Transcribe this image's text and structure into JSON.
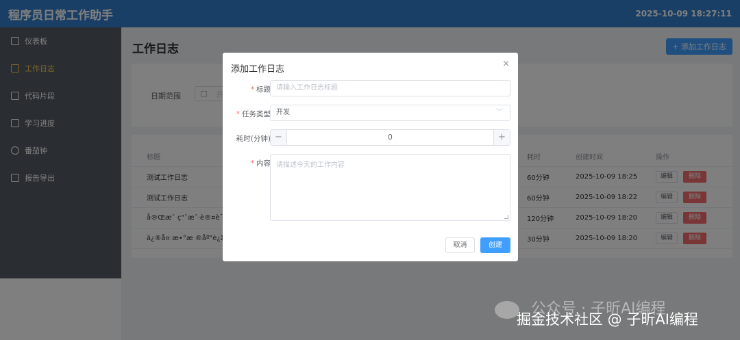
{
  "app": {
    "title": "程序员日常工作助手",
    "datetime": "2025-10-09 18:27:11"
  },
  "sidebar": {
    "items": [
      {
        "label": "仪表板",
        "icon": "dashboard-icon"
      },
      {
        "label": "工作日志",
        "icon": "document-icon",
        "active": true
      },
      {
        "label": "代码片段",
        "icon": "save-icon"
      },
      {
        "label": "学习进度",
        "icon": "book-icon"
      },
      {
        "label": "番茄钟",
        "icon": "timer-icon"
      },
      {
        "label": "报告导出",
        "icon": "briefcase-icon"
      }
    ]
  },
  "page": {
    "title": "工作日志",
    "add_button": "+ 添加工作日志"
  },
  "filter": {
    "date_label": "日期范围",
    "date_placeholder": "开"
  },
  "table": {
    "headers": {
      "title": "标题",
      "duration": "耗时",
      "created": "创建时间",
      "actions": "操作"
    },
    "rows": [
      {
        "title": "测试工作日志",
        "duration": "60分钟",
        "created": "2025-10-09 18:25"
      },
      {
        "title": "测试工作日志",
        "duration": "60分钟",
        "created": "2025-10-09 18:22"
      },
      {
        "title": "å®Œæˆ   ç\"¨æˆ·è®¤è¯  å",
        "duration": "120分钟",
        "created": "2025-10-09 18:20"
      },
      {
        "title": "ä¿®å¤   æ•°æ  ®åº\"è¿ž",
        "duration": "30分钟",
        "created": "2025-10-09 18:20"
      }
    ],
    "edit_label": "编辑",
    "delete_label": "删除"
  },
  "dialog": {
    "title": "添加工作日志",
    "close": "×",
    "title_label": "标题",
    "title_placeholder": "请输入工作日志标题",
    "type_label": "任务类型",
    "type_value": "开发",
    "time_label": "耗时(分钟)",
    "time_value": "0",
    "content_label": "内容",
    "content_placeholder": "请描述今天的工作内容",
    "cancel": "取消",
    "create": "创建"
  },
  "watermark": {
    "line1": "公众号 · 子昕AI编程",
    "line2": "掘金技术社区 @ 子昕AI编程"
  },
  "colors": {
    "primary": "#409eff",
    "danger": "#f56c6c",
    "topbar": "#337ecc",
    "sidebar": "#545c64",
    "active": "#ffd04b"
  }
}
